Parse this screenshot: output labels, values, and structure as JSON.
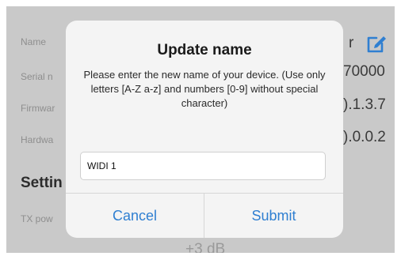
{
  "background": {
    "labels": [
      "Name",
      "Serial n",
      "Firmwar",
      "Hardwa",
      "TX pow"
    ],
    "name_value_partial": "r",
    "serial_value_partial": "70000",
    "firmware_value_partial": ").1.3.7",
    "hardware_value_partial": ").0.0.2",
    "settings_title": "Settin",
    "tx_power_value": "+3 dB"
  },
  "dialog": {
    "title": "Update name",
    "message": "Please enter the new name of your device. (Use only letters [A-Z a-z] and numbers [0-9] without special character)",
    "input_value": "WIDI 1",
    "cancel_label": "Cancel",
    "submit_label": "Submit"
  },
  "colors": {
    "accent": "#2f7fd1",
    "overlay": "#c9c9c9"
  },
  "icons": [
    "edit-icon"
  ]
}
